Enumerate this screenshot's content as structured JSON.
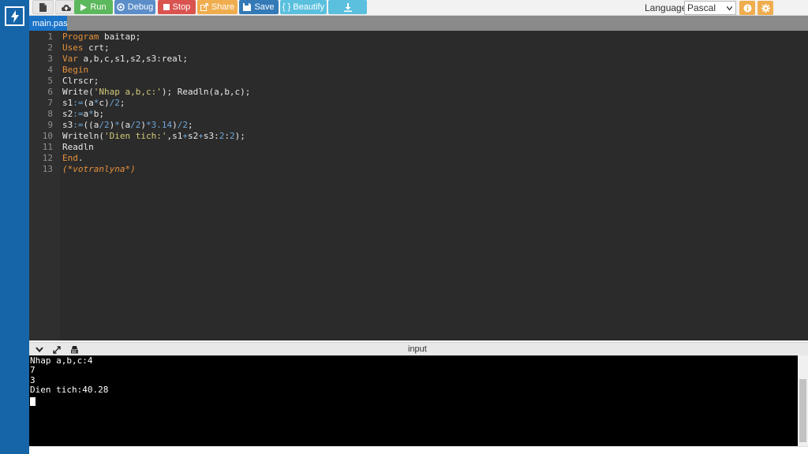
{
  "toolbar": {
    "run_label": "Run",
    "debug_label": "Debug",
    "stop_label": "Stop",
    "share_label": "Share",
    "save_label": "Save",
    "beautify_label": "{ } Beautify",
    "language_label": "Language",
    "language_value": "Pascal"
  },
  "tab": {
    "label": "main.pas"
  },
  "editor": {
    "line_numbers": [
      "1",
      "2",
      "3",
      "4",
      "5",
      "6",
      "7",
      "8",
      "9",
      "10",
      "11",
      "12",
      "13"
    ]
  },
  "console": {
    "title": "input",
    "lines": [
      "Nhap a,b,c:4",
      "7",
      "3",
      "Dien tich:40.28"
    ]
  },
  "colors": {
    "rail": "#1565a8",
    "run": "#5cb85c",
    "debug": "#5b8ec9",
    "stop": "#d9534f",
    "share": "#f0ad4e",
    "save": "#337ab7",
    "beautify": "#5bc0de",
    "editor_bg": "#2b2b2b",
    "keyword": "#e5913c",
    "string": "#d4c97a",
    "number": "#6ea6d8"
  },
  "icons": [
    "bolt-icon",
    "new-file-icon",
    "upload-icon",
    "play-icon",
    "debug-icon",
    "stop-icon",
    "share-icon",
    "save-icon",
    "download-icon",
    "info-icon",
    "gear-icon",
    "chevron-down-icon",
    "expand-icon",
    "clear-icon"
  ]
}
